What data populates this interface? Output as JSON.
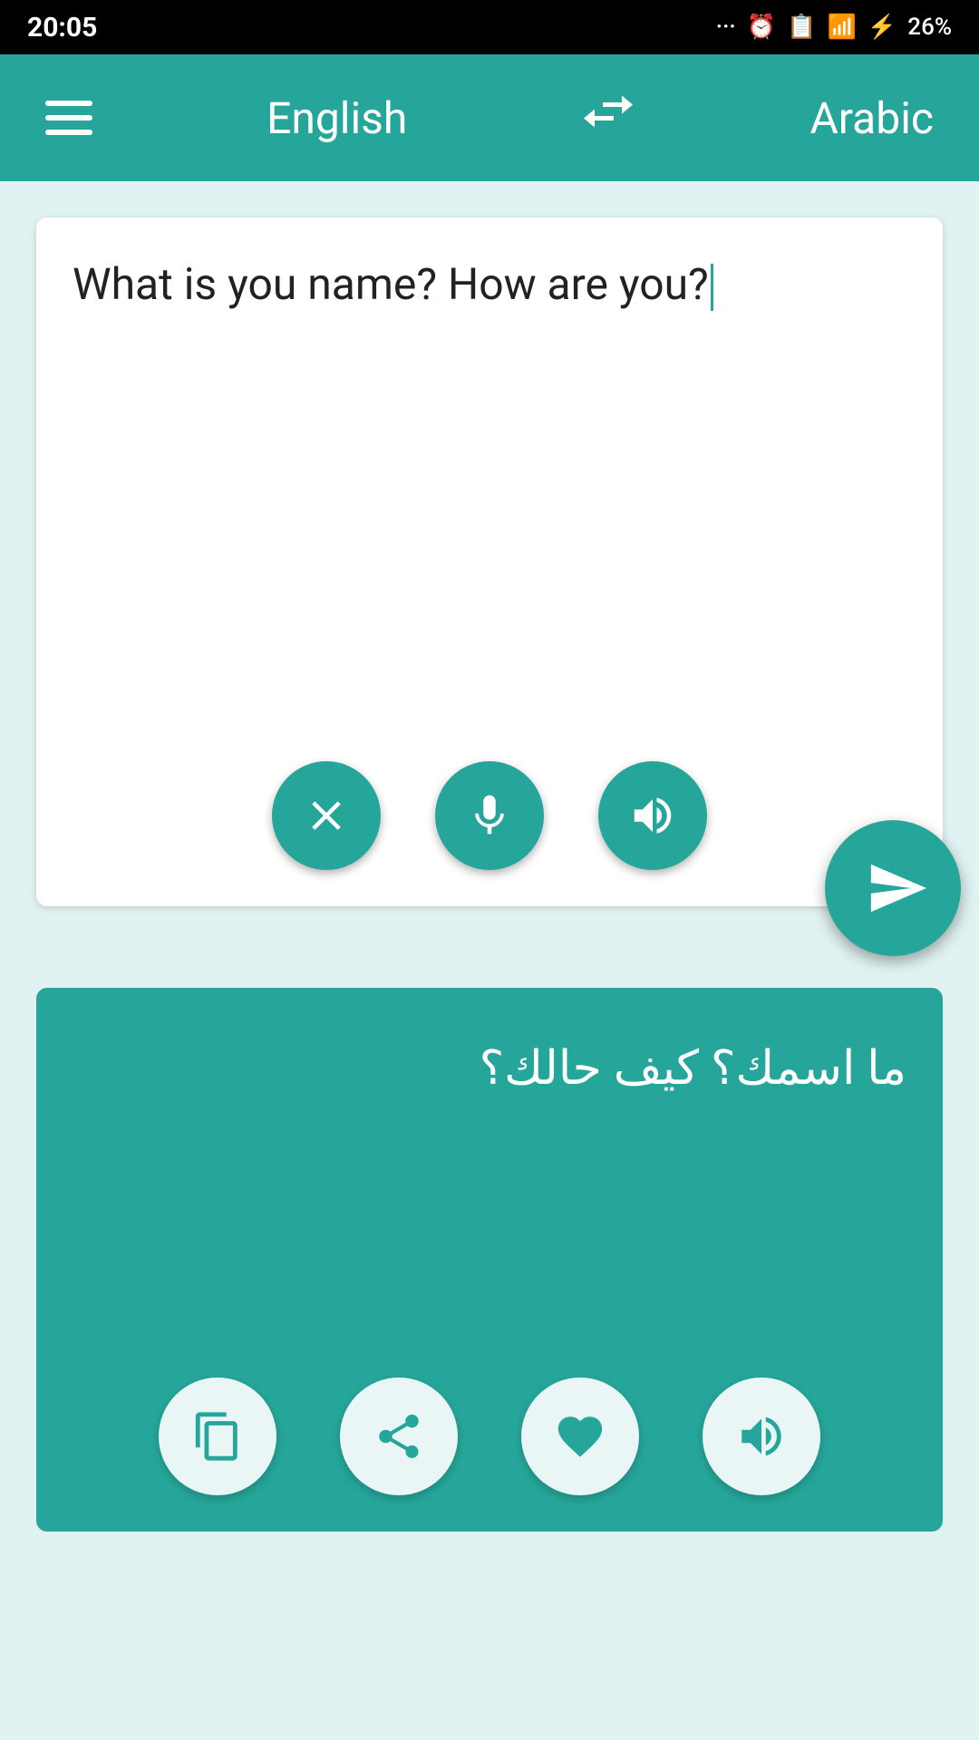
{
  "status_bar": {
    "time": "20:05",
    "battery": "26%"
  },
  "top_nav": {
    "menu_label": "Menu",
    "source_lang": "English",
    "swap_label": "Swap Languages",
    "target_lang": "Arabic"
  },
  "input_section": {
    "input_text": "What is you name? How are you?",
    "clear_label": "Clear",
    "mic_label": "Microphone",
    "speak_label": "Speak",
    "send_label": "Translate"
  },
  "output_section": {
    "translated_text": "ما اسمك؟ كيف حالك؟",
    "copy_label": "Copy",
    "share_label": "Share",
    "favorite_label": "Favorite",
    "speak_label": "Speak"
  }
}
